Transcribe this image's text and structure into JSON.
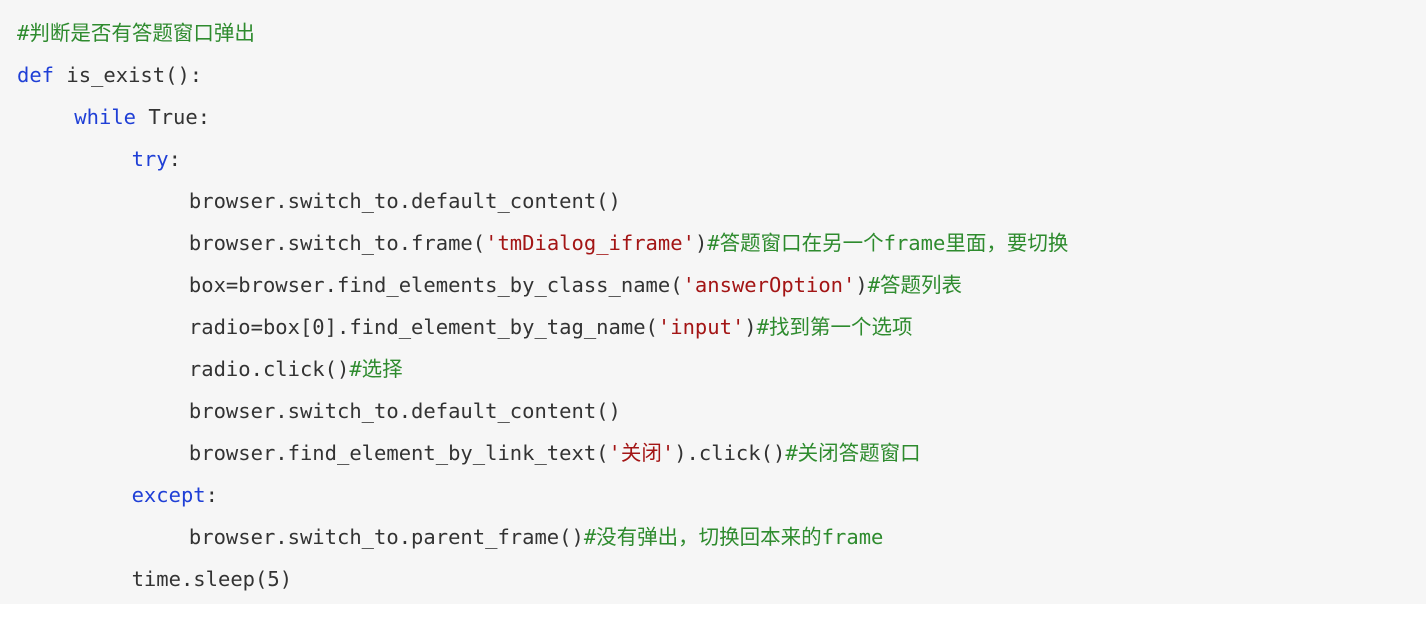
{
  "code": {
    "language": "python",
    "colors": {
      "background": "#f6f6f6",
      "keyword": "#1f3fd6",
      "string": "#a31515",
      "comment": "#2e8b2e",
      "plain": "#333333"
    },
    "lines": [
      {
        "indent": 0,
        "tokens": [
          {
            "type": "comment",
            "text": "#判断是否有答题窗口弹出"
          }
        ]
      },
      {
        "indent": 0,
        "tokens": [
          {
            "type": "keyword",
            "text": "def"
          },
          {
            "type": "plain",
            "text": " is_exist():"
          }
        ]
      },
      {
        "indent": 1,
        "tokens": [
          {
            "type": "keyword",
            "text": "while"
          },
          {
            "type": "plain",
            "text": " True:"
          }
        ]
      },
      {
        "indent": 2,
        "tokens": [
          {
            "type": "keyword",
            "text": "try"
          },
          {
            "type": "plain",
            "text": ":"
          }
        ]
      },
      {
        "indent": 3,
        "tokens": [
          {
            "type": "plain",
            "text": "browser.switch_to.default_content()"
          }
        ]
      },
      {
        "indent": 3,
        "tokens": [
          {
            "type": "plain",
            "text": "browser.switch_to.frame("
          },
          {
            "type": "string",
            "text": "'tmDialog_iframe'"
          },
          {
            "type": "plain",
            "text": ")"
          },
          {
            "type": "comment",
            "text": "#答题窗口在另一个frame里面，要切换"
          }
        ]
      },
      {
        "indent": 3,
        "tokens": [
          {
            "type": "plain",
            "text": "box=browser.find_elements_by_class_name("
          },
          {
            "type": "string",
            "text": "'answerOption'"
          },
          {
            "type": "plain",
            "text": ")"
          },
          {
            "type": "comment",
            "text": "#答题列表"
          }
        ]
      },
      {
        "indent": 3,
        "tokens": [
          {
            "type": "plain",
            "text": "radio=box[0].find_element_by_tag_name("
          },
          {
            "type": "string",
            "text": "'input'"
          },
          {
            "type": "plain",
            "text": ")"
          },
          {
            "type": "comment",
            "text": "#找到第一个选项"
          }
        ]
      },
      {
        "indent": 3,
        "tokens": [
          {
            "type": "plain",
            "text": "radio.click()"
          },
          {
            "type": "comment",
            "text": "#选择"
          }
        ]
      },
      {
        "indent": 3,
        "tokens": [
          {
            "type": "plain",
            "text": "browser.switch_to.default_content()"
          }
        ]
      },
      {
        "indent": 3,
        "tokens": [
          {
            "type": "plain",
            "text": "browser.find_element_by_link_text("
          },
          {
            "type": "string",
            "text": "'关闭'"
          },
          {
            "type": "plain",
            "text": ").click()"
          },
          {
            "type": "comment",
            "text": "#关闭答题窗口"
          }
        ]
      },
      {
        "indent": 2,
        "tokens": [
          {
            "type": "keyword",
            "text": "except"
          },
          {
            "type": "plain",
            "text": ":"
          }
        ]
      },
      {
        "indent": 3,
        "tokens": [
          {
            "type": "plain",
            "text": "browser.switch_to.parent_frame()"
          },
          {
            "type": "comment",
            "text": "#没有弹出，切换回本来的frame"
          }
        ]
      },
      {
        "indent": 2,
        "tokens": [
          {
            "type": "plain",
            "text": "time.sleep(5)"
          }
        ]
      }
    ]
  }
}
